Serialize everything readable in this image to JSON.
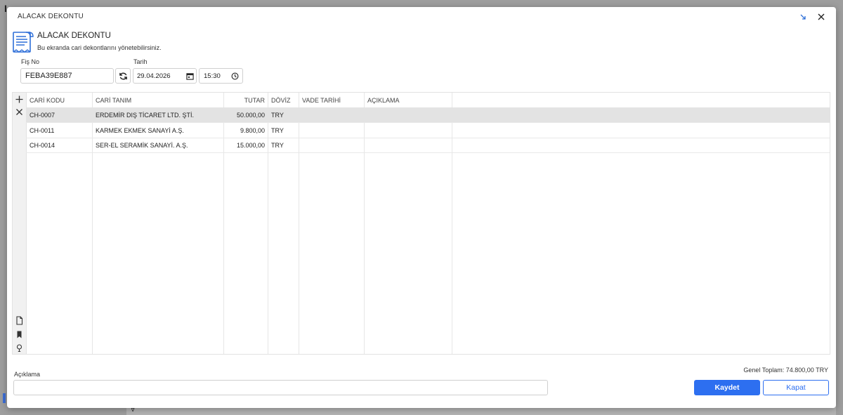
{
  "window": {
    "title": "ALACAK DEKONTU"
  },
  "header": {
    "title": "ALACAK DEKONTU",
    "subtitle": "Bu ekranda cari dekontlarını yönetebilirsiniz."
  },
  "form": {
    "fis_no_label": "Fiş No",
    "fis_no_value": "FEBA39E887",
    "tarih_label": "Tarih",
    "date_value": "29.04.2026",
    "time_value": "15:30"
  },
  "grid": {
    "columns": [
      "CARİ KODU",
      "CARİ TANIM",
      "TUTAR",
      "DÖVİZ",
      "VADE TARİHİ",
      "AÇIKLAMA"
    ],
    "rows": [
      {
        "kod": "CH-0007",
        "tanim": "ERDEMİR DIŞ TİCARET LTD. ŞTİ.",
        "tutar": "50.000,00",
        "doviz": "TRY",
        "vade": "",
        "aciklama": ""
      },
      {
        "kod": "CH-0011",
        "tanim": "KARMEK EKMEK SANAYİ A.Ş.",
        "tutar": "9.800,00",
        "doviz": "TRY",
        "vade": "",
        "aciklama": ""
      },
      {
        "kod": "CH-0014",
        "tanim": "SER-EL SERAMİK SANAYİ. A.Ş.",
        "tutar": "15.000,00",
        "doviz": "TRY",
        "vade": "",
        "aciklama": ""
      }
    ],
    "selected_row": 0
  },
  "footer": {
    "aciklama_label": "Açıklama",
    "aciklama_value": "",
    "total_text": "Genel Toplam: 74.800,00 TRY",
    "save_label": "Kaydet",
    "close_label": "Kapat"
  },
  "colors": {
    "primary": "#2d6ff0",
    "icon_blue": "#2e6fd8",
    "selected_row": "#e3e3e3"
  },
  "icons": [
    "receipt-icon",
    "refresh-icon",
    "calendar-icon",
    "clock-icon",
    "add-icon",
    "delete-icon",
    "document-icon",
    "bookmark-icon",
    "lightbulb-icon",
    "minimize-icon",
    "close-icon"
  ]
}
